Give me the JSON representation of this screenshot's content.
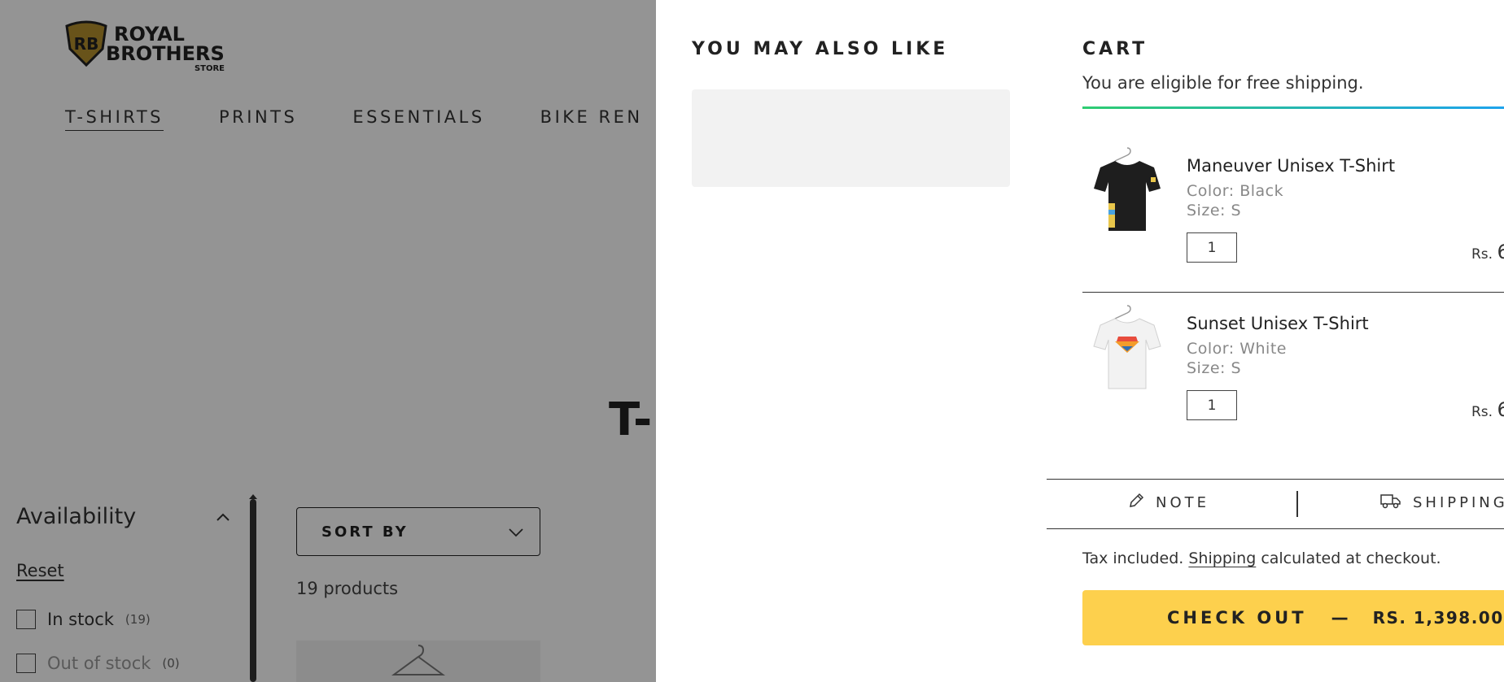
{
  "brand": {
    "line1": "ROYAL",
    "line2": "BROTHERS",
    "line3": "STORE",
    "monogram": "RB",
    "accent": "#b38f2e"
  },
  "nav": {
    "items": [
      {
        "label": "T-SHIRTS",
        "active": true
      },
      {
        "label": "PRINTS"
      },
      {
        "label": "ESSENTIALS"
      },
      {
        "label": "BIKE REN"
      }
    ]
  },
  "collection": {
    "title": "T-"
  },
  "filters": {
    "availability": {
      "title": "Availability",
      "reset": "Reset",
      "options": [
        {
          "label": "In stock",
          "count": "(19)"
        },
        {
          "label": "Out of stock",
          "count": "(0)"
        }
      ]
    }
  },
  "sort": {
    "label": "SORT BY"
  },
  "products": {
    "count_text": "19 products"
  },
  "upsell": {
    "title": "YOU MAY ALSO LIKE"
  },
  "cart": {
    "title": "CART",
    "shipping_message": "You are eligible for free shipping.",
    "progress_fraction": 1.0,
    "items": [
      {
        "name": "Maneuver Unisex T-Shirt",
        "color": "Color: Black",
        "size": "Size: S",
        "qty": "1",
        "price_prefix": "Rs.",
        "price_first": "6",
        "shirt_color": "#1e1e1e"
      },
      {
        "name": "Sunset Unisex T-Shirt",
        "color": "Color: White",
        "size": "Size: S",
        "qty": "1",
        "price_prefix": "Rs.",
        "price_first": "6",
        "shirt_color": "#f2f2f2"
      }
    ],
    "tools": {
      "note": "NOTE",
      "shipping": "SHIPPING"
    },
    "tax_prefix": "Tax included.",
    "tax_link": "Shipping",
    "tax_suffix": "calculated at checkout.",
    "checkout": {
      "label": "CHECK OUT",
      "separator": "—",
      "amount": "RS. 1,398.00",
      "color": "#fdd04d"
    }
  }
}
